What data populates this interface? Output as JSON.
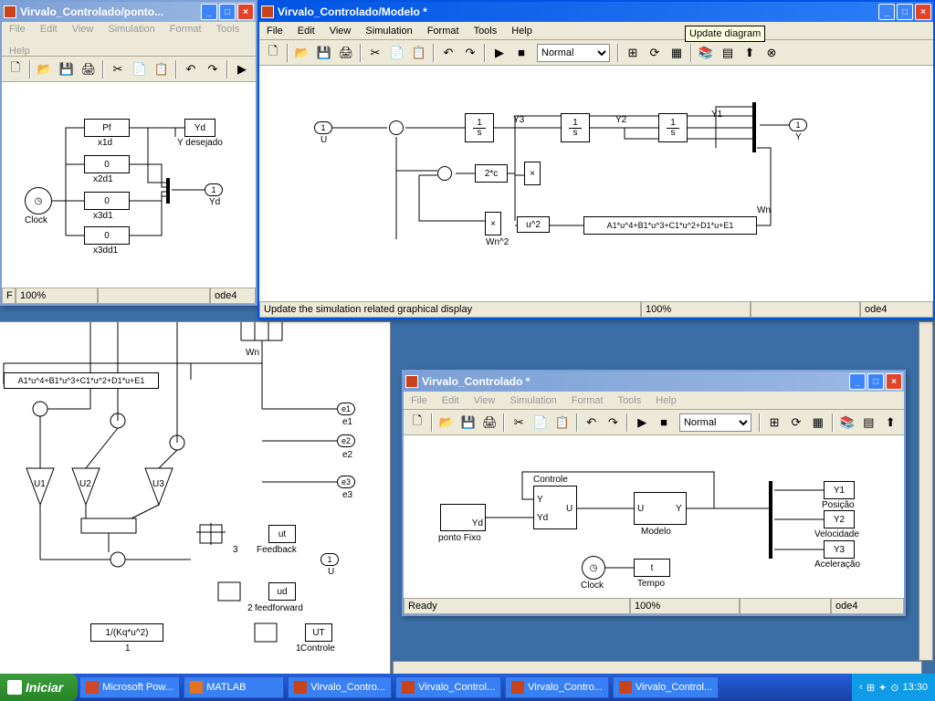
{
  "taskbar": {
    "start": "Iniciar",
    "items": [
      "Microsoft Pow...",
      "MATLAB",
      "Virvalo_Contro...",
      "Virvalo_Control...",
      "Virvalo_Contro...",
      "Virvalo_Control..."
    ],
    "clock": "13:30"
  },
  "window1": {
    "title": "Virvalo_Controlado/ponto...",
    "menus": [
      "File",
      "Edit",
      "View",
      "Simulation",
      "Format",
      "Tools",
      "Help"
    ],
    "blocks": {
      "pf": "Pf",
      "pf_label": "x1d",
      "z1": "0",
      "z1_label": "x2d1",
      "z2": "0",
      "z2_label": "x3d1",
      "z3": "0",
      "z3_label": "x3dd1",
      "yd_box": "Yd",
      "yd_label": "Y desejado",
      "clock": "Clock",
      "port_out": "1",
      "port_out_label": "Yd"
    },
    "status_zoom": "100%",
    "status_solver": "ode4",
    "status_type": "F"
  },
  "window2": {
    "title": "Virvalo_Controlado/Modelo *",
    "menus": [
      "File",
      "Edit",
      "View",
      "Simulation",
      "Format",
      "Tools",
      "Help"
    ],
    "select_mode": "Normal",
    "tooltip": "Update diagram",
    "status_text": "Update the simulation related graphical display",
    "status_zoom": "100%",
    "status_solver": "ode4",
    "blocks": {
      "port_in": "1",
      "port_in_label": "U",
      "int1": "1/s",
      "int2": "1/s",
      "int3": "1/s",
      "y3": "Y3",
      "y2": "Y2",
      "y1": "Y1",
      "port_out": "1",
      "port_out_label": "Y",
      "two_c": "2*c",
      "wn": "Wn",
      "fcn": "A1*u^4+B1*u^3+C1*u^2+D1*u+E1",
      "u2": "u^2",
      "wn2": "Wn^2"
    }
  },
  "window3": {
    "title": "Virvalo_Controlado *",
    "menus": [
      "File",
      "Edit",
      "View",
      "Simulation",
      "Format",
      "Tools",
      "Help"
    ],
    "select_mode": "Normal",
    "status_text": "Ready",
    "status_zoom": "100%",
    "status_solver": "ode4",
    "blocks": {
      "pf": "Yd",
      "pf_label": "ponto Fixo",
      "ctrl_label": "Controle",
      "ctrl_y": "Y",
      "ctrl_yd": "Yd",
      "ctrl_u": "U",
      "mdl_u": "U",
      "mdl_y": "Y",
      "mdl_label": "Modelo",
      "clock": "Clock",
      "t": "t",
      "t_label": "Tempo",
      "y1": "Y1",
      "y1_label": "Posição",
      "y2": "Y2",
      "y2_label": "Velocidade",
      "y3": "Y3",
      "y3_label": "Aceleração"
    }
  },
  "background_canvas": {
    "wn": "Wn",
    "fcn": "A1*u^4+B1*u^3+C1*u^2+D1*u+E1",
    "u1": "U1",
    "u2": "U2",
    "u3": "U3",
    "e1": "e1",
    "e2": "e2",
    "e3": "e3",
    "ut": "ut",
    "ut_label": "Feedback",
    "ud": "ud",
    "ud_label": "feedforward",
    "UT": "UT",
    "UT_label": "Controle",
    "kq": "1/(Kq*u^2)",
    "kq_label": "1",
    "port_u": "1",
    "port_u_label": "U",
    "n3": "3",
    "n2": "2",
    "n1": "1"
  }
}
